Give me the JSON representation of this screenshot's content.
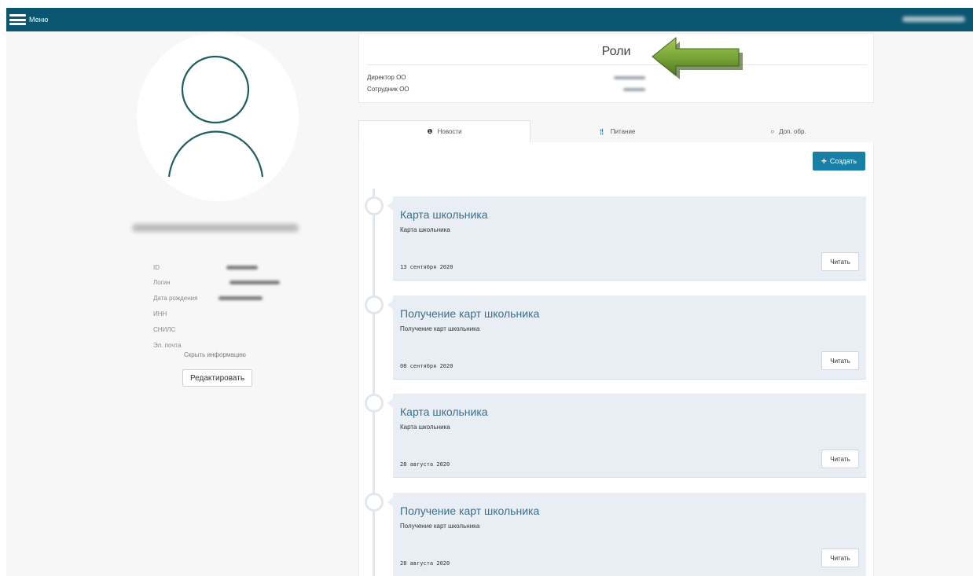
{
  "header": {
    "menu_label": "Меню"
  },
  "profile": {
    "fields": [
      {
        "label": "ID"
      },
      {
        "label": "Логин"
      },
      {
        "label": "Дата рождения"
      },
      {
        "label": "ИНН"
      },
      {
        "label": "СНИЛС"
      },
      {
        "label": "Эл. почта"
      }
    ],
    "hide_label": "Скрыть информацию",
    "edit_label": "Редактировать"
  },
  "roles": {
    "title": "Роли",
    "items": [
      {
        "name": "Директор ОО"
      },
      {
        "name": "Сотрудник ОО"
      }
    ]
  },
  "tabs": [
    {
      "label": "Новости",
      "icon": "exclamation-circle-icon",
      "active": true
    },
    {
      "label": "Питание",
      "icon": "fork-knife-icon",
      "active": false
    },
    {
      "label": "Доп. обр.",
      "icon": "circle-icon",
      "active": false
    }
  ],
  "create_label": "Создать",
  "news": [
    {
      "title": "Карта школьника",
      "subtitle": "Карта школьника",
      "date": "13 сентября 2020",
      "read_label": "Читать"
    },
    {
      "title": "Получение карт школьника",
      "subtitle": "Получение карт школьника",
      "date": "08 сентября 2020",
      "read_label": "Читать"
    },
    {
      "title": "Карта школьника",
      "subtitle": "Карта школьника",
      "date": "28 августа 2020",
      "read_label": "Читать"
    },
    {
      "title": "Получение карт школьника",
      "subtitle": "Получение карт школьника",
      "date": "28 августа 2020",
      "read_label": "Читать"
    }
  ],
  "colors": {
    "topbar": "#0a5670",
    "accent": "#1a7fa6",
    "news_card": "#e8eef4",
    "arrow": "#7aa63a"
  }
}
